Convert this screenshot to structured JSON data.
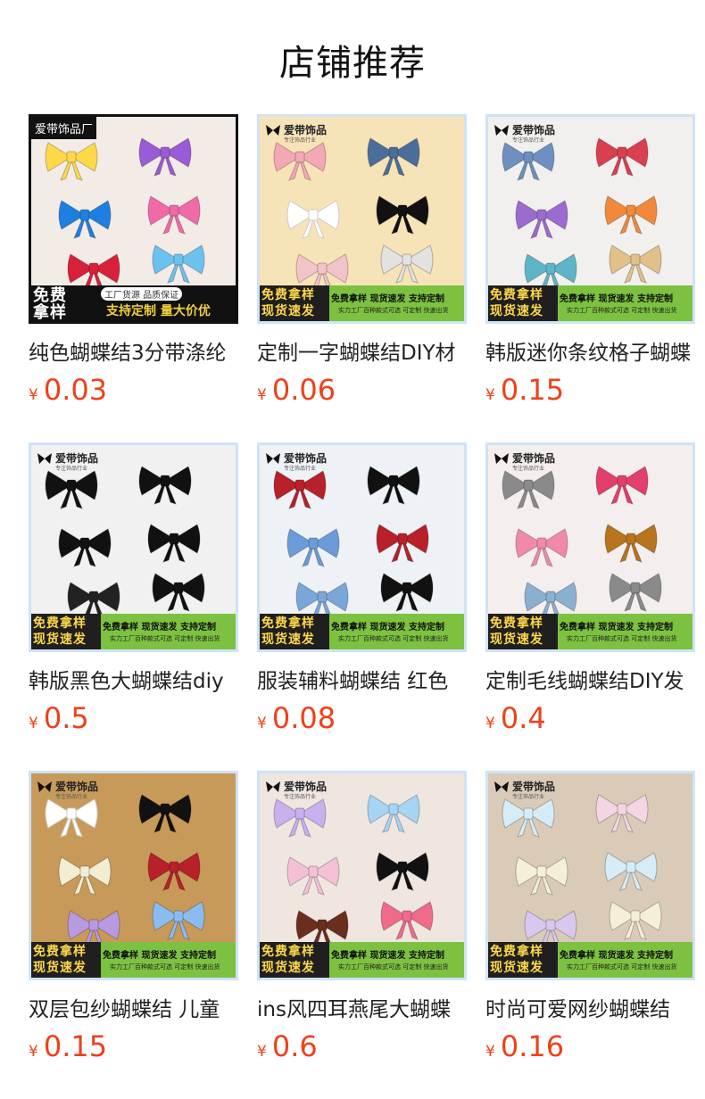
{
  "page_title": "店铺推荐",
  "products": [
    {
      "title": "纯色蝴蝶结3分带涤纶",
      "currency": "¥",
      "price": "0.03",
      "brand": "爱带饰品厂",
      "banner_left": "免费\n拿样",
      "banner_top": "工厂货源 品质保证",
      "banner_bottom": "支持定制 量大价优",
      "bg": "#f3ece6"
    },
    {
      "title": "定制一字蝴蝶结DIY材",
      "currency": "¥",
      "price": "0.06",
      "brand": "爱带饰品",
      "brand_sub": "专注饰品行业",
      "banner_left": "免费拿样\n现货速发",
      "banner_top": "免费拿样 现货速发 支持定制",
      "banner_bottom": "实力工厂百种款式可选 可定制 快速出货",
      "bg": "#f7e3b8"
    },
    {
      "title": "韩版迷你条纹格子蝴蝶",
      "currency": "¥",
      "price": "0.15",
      "brand": "爱带饰品",
      "brand_sub": "专注饰品行业",
      "banner_left": "免费拿样\n现货速发",
      "banner_top": "免费拿样 现货速发 支持定制",
      "banner_bottom": "实力工厂百种款式可选 可定制 快速出货",
      "bg": "#f2f0ee"
    },
    {
      "title": "韩版黑色大蝴蝶结diy",
      "currency": "¥",
      "price": "0.5",
      "brand": "爱带饰品",
      "brand_sub": "专注饰品行业",
      "banner_left": "免费拿样\n现货速发",
      "banner_top": "免费拿样 现货速发 支持定制",
      "banner_bottom": "实力工厂百种款式可选 可定制 快速出货",
      "bg": "#f1f1f1"
    },
    {
      "title": "服装辅料蝴蝶结 红色",
      "currency": "¥",
      "price": "0.08",
      "brand": "爱带饰品",
      "brand_sub": "专注饰品行业",
      "banner_left": "免费拿样\n现货速发",
      "banner_top": "免费拿样 现货速发 支持定制",
      "banner_bottom": "实力工厂百种款式可选 可定制 快速出货",
      "bg": "#eef2f6"
    },
    {
      "title": "定制毛线蝴蝶结DIY发",
      "currency": "¥",
      "price": "0.4",
      "brand": "爱带饰品",
      "brand_sub": "专注饰品行业",
      "banner_left": "免费拿样\n现货速发",
      "banner_top": "免费拿样 现货速发 支持定制",
      "banner_bottom": "实力工厂百种款式可选 可定制 快速出货",
      "bg": "#f4efee"
    },
    {
      "title": "双层包纱蝴蝶结 儿童",
      "currency": "¥",
      "price": "0.15",
      "brand": "爱带饰品",
      "brand_sub": "专注饰品行业",
      "banner_left": "免费拿样\n现货速发",
      "banner_top": "免费拿样 现货速发 支持定制",
      "banner_bottom": "实力工厂百种款式可选 可定制 快速出货",
      "bg": "#c79a5a"
    },
    {
      "title": "ins风四耳燕尾大蝴蝶",
      "currency": "¥",
      "price": "0.6",
      "brand": "爱带饰品",
      "brand_sub": "专注饰品行业",
      "banner_left": "免费拿样\n现货速发",
      "banner_top": "免费拿样 现货速发 支持定制",
      "banner_bottom": "实力工厂百种款式可选 可定制 快速出货",
      "bg": "#efe6e0"
    },
    {
      "title": "时尚可爱网纱蝴蝶结",
      "currency": "¥",
      "price": "0.16",
      "brand": "爱带饰品",
      "brand_sub": "专注饰品行业",
      "banner_left": "免费拿样\n现货速发",
      "banner_top": "免费拿样 现货速发 支持定制",
      "banner_bottom": "实力工厂百种款式可选 可定制 快速出货",
      "bg": "#d9cbb8"
    }
  ]
}
